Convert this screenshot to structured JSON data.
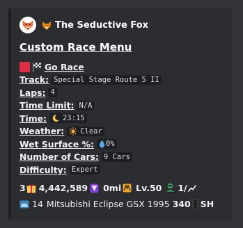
{
  "embed": {
    "author": {
      "name": "The Seductive Fox",
      "icon": "fox-emoji",
      "avatar": "fox-avatar"
    },
    "title": "Custom Race Menu",
    "go_race": {
      "icons": [
        "red-square",
        "checkered-flag-icon"
      ],
      "label": "Go Race"
    },
    "fields": [
      {
        "label": "Track:",
        "value": "Special Stage Route 5 II"
      },
      {
        "label": "Laps:",
        "value": "4"
      },
      {
        "label": "Time Limit:",
        "value": "N/A"
      },
      {
        "label": "Time:",
        "icon": "crescent-moon-icon",
        "value": "23:15"
      },
      {
        "label": "Weather:",
        "icon": "sun-icon",
        "value": "Clear"
      },
      {
        "label": "Wet Surface %:",
        "icon": "droplet-icon",
        "value": "0%"
      },
      {
        "label": "Number of Cars:",
        "value": "9 Cars"
      },
      {
        "label": "Difficulty:",
        "value": "Expert"
      }
    ],
    "stats": {
      "count": "3",
      "credits": "4,442,589",
      "mileage": "0mi",
      "level": "Lv.50",
      "rank": "1/"
    },
    "car": {
      "badge_number": "14",
      "model": "Mitsubishi Eclipse GSX 1995",
      "power": "340",
      "tyre": "SH"
    },
    "colors": {
      "background": "#313338",
      "embed": "#2b2d31",
      "accent_bar": "#1e1f22",
      "red_square": "#dd2e44"
    }
  }
}
